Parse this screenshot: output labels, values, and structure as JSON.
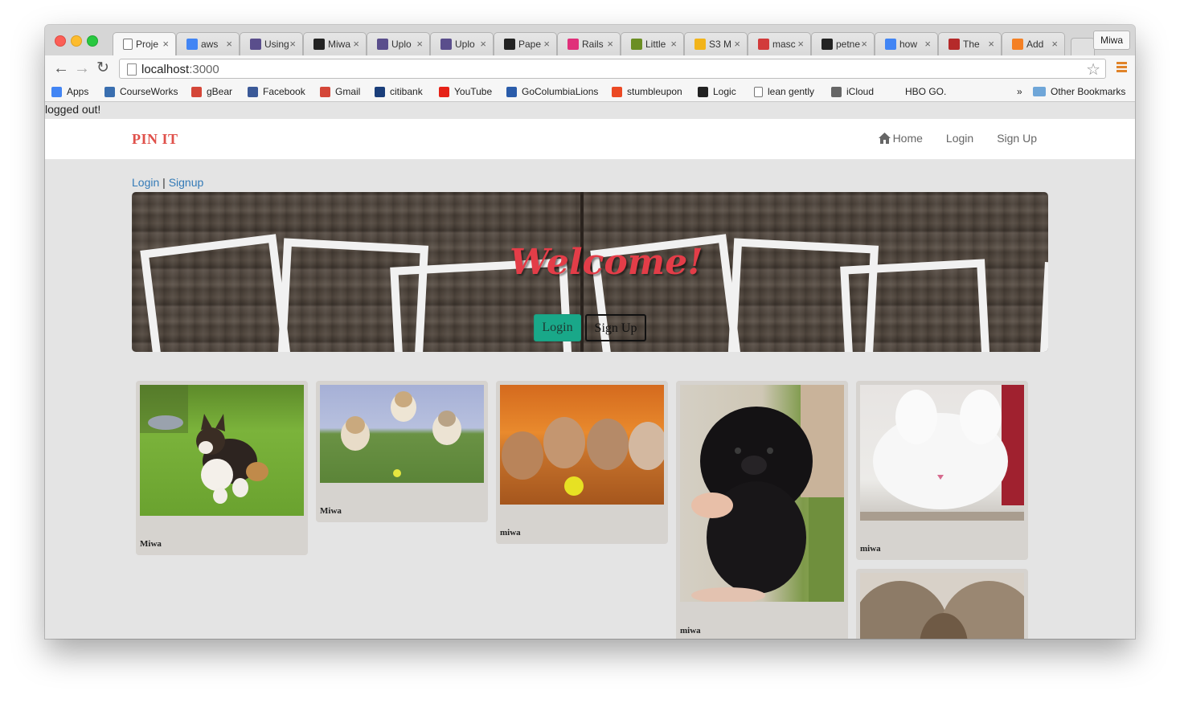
{
  "browser": {
    "tabs": [
      {
        "label": "Proje",
        "icon": "page-icon",
        "color": "#ffffff"
      },
      {
        "label": "aws",
        "icon": "google-icon",
        "color": "#4285f4"
      },
      {
        "label": "Using",
        "icon": "heroku-icon",
        "color": "#5a4e8c"
      },
      {
        "label": "Miwa",
        "icon": "github-icon",
        "color": "#222222"
      },
      {
        "label": "Uplo",
        "icon": "heroku-icon",
        "color": "#5a4e8c"
      },
      {
        "label": "Uplo",
        "icon": "heroku-icon",
        "color": "#5a4e8c"
      },
      {
        "label": "Pape",
        "icon": "github-icon",
        "color": "#222222"
      },
      {
        "label": "Rails",
        "icon": "railscasts-icon",
        "color": "#e0307a"
      },
      {
        "label": "Little",
        "icon": "little-icon",
        "color": "#6b8e23"
      },
      {
        "label": "S3 M",
        "icon": "s3-icon",
        "color": "#f2b41a"
      },
      {
        "label": "masc",
        "icon": "shield-icon",
        "color": "#d23b3b"
      },
      {
        "label": "petne",
        "icon": "github-icon",
        "color": "#222222"
      },
      {
        "label": "how",
        "icon": "google-icon",
        "color": "#4285f4"
      },
      {
        "label": "The",
        "icon": "the-icon",
        "color": "#b52a2a"
      },
      {
        "label": "Add",
        "icon": "stackoverflow-icon",
        "color": "#f48024"
      }
    ],
    "profile": "Miwa",
    "url_host": "localhost",
    "url_port": ":3000",
    "bookmarks": [
      {
        "label": "Apps",
        "icon": "apps-icon",
        "color": "#4285f4"
      },
      {
        "label": "CourseWorks",
        "icon": "crown-icon",
        "color": "#3a6fb0"
      },
      {
        "label": "gBear",
        "icon": "gmail-icon",
        "color": "#d44638"
      },
      {
        "label": "Facebook",
        "icon": "facebook-icon",
        "color": "#3b5998"
      },
      {
        "label": "Gmail",
        "icon": "gmail-icon",
        "color": "#d44638"
      },
      {
        "label": "citibank",
        "icon": "citi-icon",
        "color": "#1a3e7a"
      },
      {
        "label": "YouTube",
        "icon": "youtube-icon",
        "color": "#e62117"
      },
      {
        "label": "GoColumbiaLions",
        "icon": "lion-shield-icon",
        "color": "#2a5caa"
      },
      {
        "label": "stumbleupon",
        "icon": "stumbleupon-icon",
        "color": "#eb4924"
      },
      {
        "label": "Logic",
        "icon": "logic-icon",
        "color": "#222222"
      },
      {
        "label": "lean gently",
        "icon": "page-icon",
        "color": "#ffffff"
      },
      {
        "label": "iCloud",
        "icon": "apple-icon",
        "color": "#666666"
      },
      {
        "label": "HBO GO.",
        "icon": "",
        "color": ""
      }
    ],
    "overflow": "»",
    "other_bookmarks": "Other Bookmarks"
  },
  "page": {
    "flash": "logged out!",
    "brand": "PIN IT",
    "nav": {
      "home": "Home",
      "login": "Login",
      "signup": "Sign Up"
    },
    "auth_links": {
      "login": "Login",
      "separator": "|",
      "signup": "Signup"
    },
    "hero": {
      "title": "Welcome!",
      "login_button": "Login",
      "signup_button": "Sign Up"
    },
    "pins": [
      {
        "author": "Miwa",
        "subject": "corgi puppy running on grass"
      },
      {
        "author": "Miwa",
        "subject": "three fluffy puppies on grass"
      },
      {
        "author": "miwa",
        "subject": "puppies with yellow ball"
      },
      {
        "author": "miwa",
        "subject": "black fluffy puppy held in arms"
      },
      {
        "author": "miwa",
        "subject": "white fluffy angora rabbit"
      },
      {
        "author": "",
        "subject": "long haired dog"
      }
    ]
  }
}
